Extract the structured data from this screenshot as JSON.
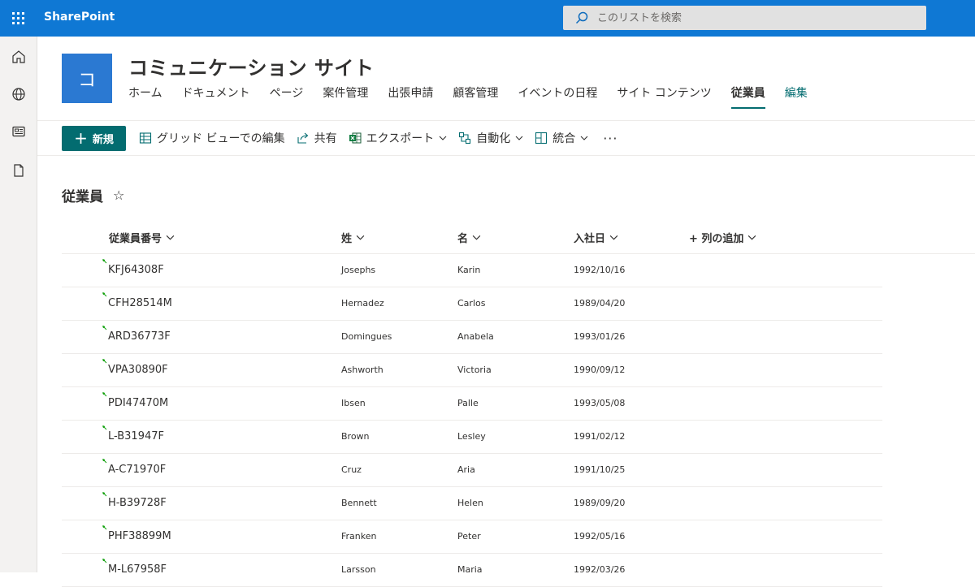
{
  "app": {
    "name": "SharePoint"
  },
  "search": {
    "placeholder": "このリストを検索"
  },
  "site": {
    "logo_letter": "コ",
    "title": "コミュニケーション サイト",
    "nav": [
      {
        "label": "ホーム"
      },
      {
        "label": "ドキュメント"
      },
      {
        "label": "ページ"
      },
      {
        "label": "案件管理"
      },
      {
        "label": "出張申請"
      },
      {
        "label": "顧客管理"
      },
      {
        "label": "イベントの日程"
      },
      {
        "label": "サイト コンテンツ"
      },
      {
        "label": "従業員",
        "active": true
      },
      {
        "label": "編集"
      }
    ]
  },
  "left_rail": {
    "icons": [
      "home-icon",
      "globe-icon",
      "news-icon",
      "document-icon"
    ]
  },
  "commands": {
    "new_label": "新規",
    "grid_view_label": "グリッド ビューでの編集",
    "share_label": "共有",
    "export_label": "エクスポート",
    "automate_label": "自動化",
    "integrate_label": "統合",
    "more_label": "···"
  },
  "list": {
    "title": "従業員",
    "columns": {
      "employee_id": "従業員番号",
      "last_name": "姓",
      "first_name": "名",
      "hire_date": "入社日",
      "add_column": "+ 列の追加"
    },
    "rows": [
      {
        "employee_id": "KFJ64308F",
        "last_name": "Josephs",
        "first_name": "Karin",
        "hire_date": "1992/10/16"
      },
      {
        "employee_id": "CFH28514M",
        "last_name": "Hernadez",
        "first_name": "Carlos",
        "hire_date": "1989/04/20"
      },
      {
        "employee_id": "ARD36773F",
        "last_name": "Domingues",
        "first_name": "Anabela",
        "hire_date": "1993/01/26"
      },
      {
        "employee_id": "VPA30890F",
        "last_name": "Ashworth",
        "first_name": "Victoria",
        "hire_date": "1990/09/12"
      },
      {
        "employee_id": "PDI47470M",
        "last_name": "Ibsen",
        "first_name": "Palle",
        "hire_date": "1993/05/08"
      },
      {
        "employee_id": "L-B31947F",
        "last_name": "Brown",
        "first_name": "Lesley",
        "hire_date": "1991/02/12"
      },
      {
        "employee_id": "A-C71970F",
        "last_name": "Cruz",
        "first_name": "Aria",
        "hire_date": "1991/10/25"
      },
      {
        "employee_id": "H-B39728F",
        "last_name": "Bennett",
        "first_name": "Helen",
        "hire_date": "1989/09/20"
      },
      {
        "employee_id": "PHF38899M",
        "last_name": "Franken",
        "first_name": "Peter",
        "hire_date": "1992/05/16"
      },
      {
        "employee_id": "M-L67958F",
        "last_name": "Larsson",
        "first_name": "Maria",
        "hire_date": "1992/03/26"
      }
    ]
  },
  "colors": {
    "suite_bar": "#0f78d4",
    "accent": "#036c70",
    "site_logo": "#2b79d2",
    "new_item_mark": "#13a10e"
  }
}
